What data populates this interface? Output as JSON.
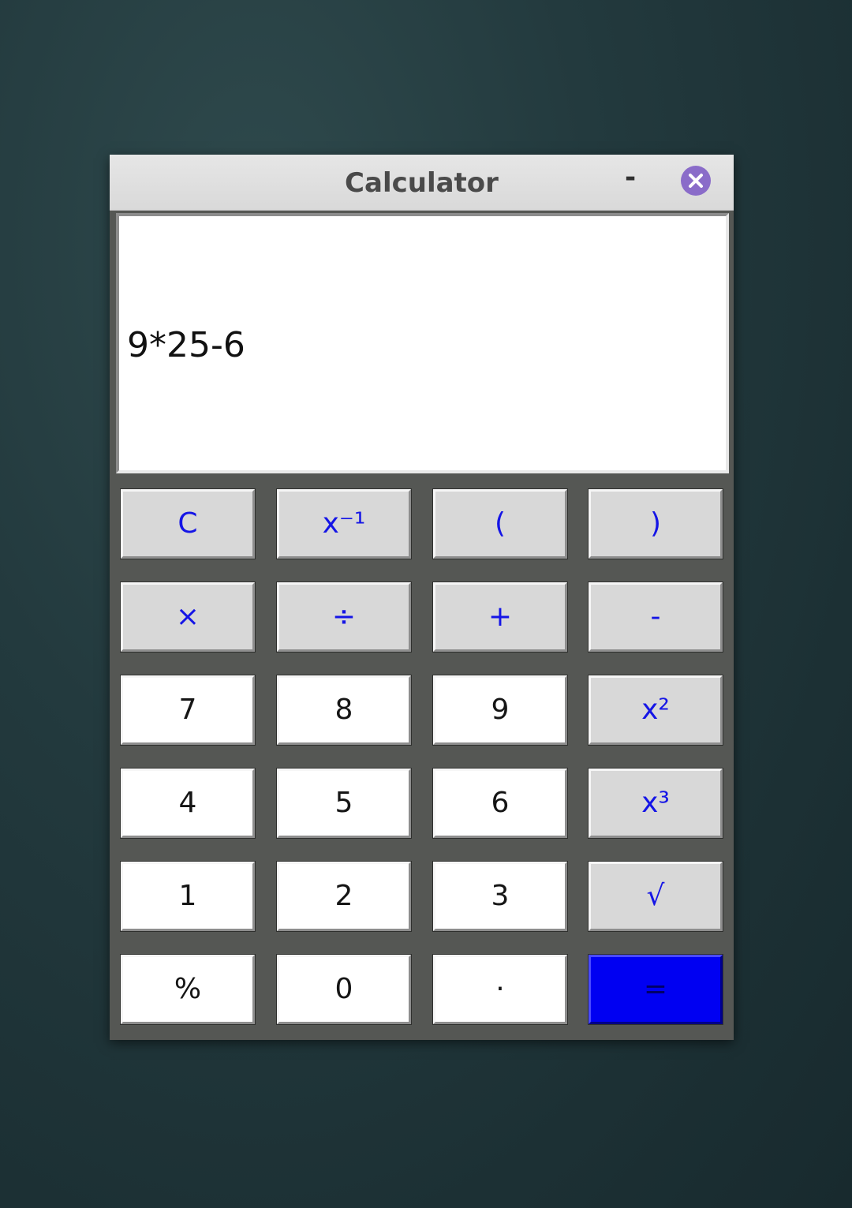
{
  "window": {
    "title": "Calculator",
    "minimize_label": "-"
  },
  "display": {
    "expression": "9*25-6"
  },
  "keypad": {
    "rows": [
      [
        "C",
        "x⁻¹",
        "(",
        ")"
      ],
      [
        "×",
        "÷",
        "+",
        "-"
      ],
      [
        "7",
        "8",
        "9",
        "x²"
      ],
      [
        "4",
        "5",
        "6",
        "x³"
      ],
      [
        "1",
        "2",
        "3",
        "√"
      ],
      [
        "%",
        "0",
        "·",
        "="
      ]
    ]
  },
  "colors": {
    "operator_text": "#1515e6",
    "equals_bg": "#0000f2",
    "close_button": "#8a6cc9"
  }
}
